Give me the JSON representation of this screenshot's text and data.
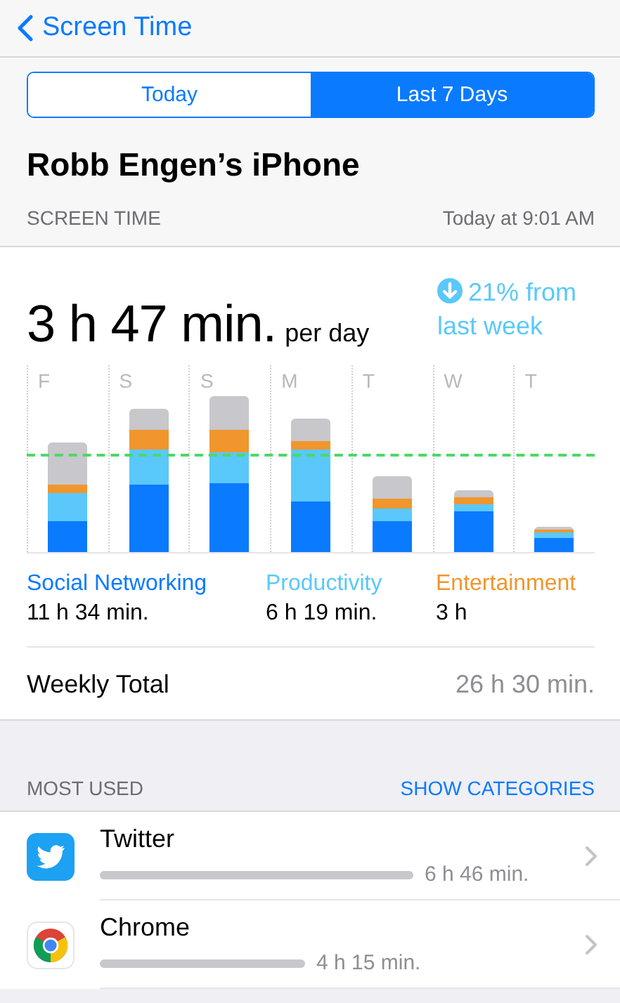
{
  "nav": {
    "back_label": "Screen Time"
  },
  "tabs": [
    {
      "label": "Today",
      "selected": false
    },
    {
      "label": "Last 7 Days",
      "selected": true
    }
  ],
  "device_title": "Robb Engen’s iPhone",
  "section": {
    "label": "SCREEN TIME",
    "updated": "Today at 9:01 AM"
  },
  "summary": {
    "average": "3 h 47 min.",
    "unit": "per day",
    "change_lines": [
      "21% from",
      "last week"
    ]
  },
  "days": [
    "F",
    "S",
    "S",
    "M",
    "T",
    "W",
    "T"
  ],
  "categories": [
    {
      "name": "Social Networking",
      "total": "11 h 34 min.",
      "color": "#0a7aff"
    },
    {
      "name": "Productivity",
      "total": "6 h 19 min.",
      "color": "#5ac8fa"
    },
    {
      "name": "Entertainment",
      "total": "3 h",
      "color": "#f0962d"
    }
  ],
  "weekly_total": {
    "label": "Weekly Total",
    "value": "26 h 30 min."
  },
  "most_used": {
    "label": "MOST USED",
    "action": "SHOW CATEGORIES"
  },
  "apps": [
    {
      "name": "Twitter",
      "kind": "twitter",
      "time": "6 h 46 min."
    },
    {
      "name": "Chrome",
      "kind": "chrome",
      "time": "4 h 15 min."
    }
  ]
}
